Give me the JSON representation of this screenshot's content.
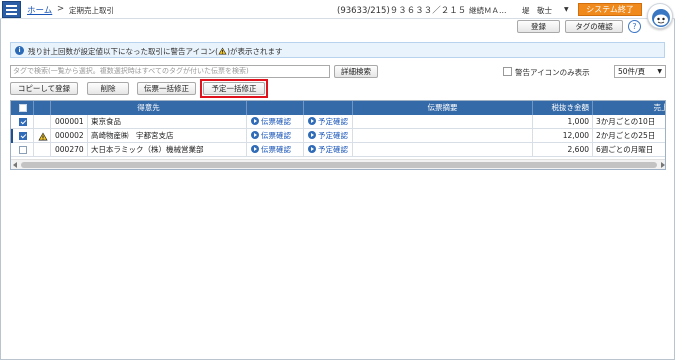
{
  "header": {
    "home_link": "ホーム",
    "breadcrumb_separator": ">",
    "current_page": "定期売上取引",
    "user_info": "(93633/215)９３６３３／２１５",
    "company": "継続ＭＡ…",
    "username": "堤　敬士",
    "user_caret": "▼",
    "system_end_label": "システム終了"
  },
  "toolbar": {
    "register_label": "登録",
    "tag_check_label": "タグの確認",
    "help_label": "?"
  },
  "info_bar": {
    "text_before": "残り計上回数が設定値以下になった取引に警告アイコン(",
    "text_after": ")が表示されます"
  },
  "search": {
    "placeholder": "タグで検索(一覧から選択。複数選択時はすべてのタグが付いた伝票を検索)",
    "detail_search_label": "詳細検索",
    "warn_only_label": "警告アイコンのみ表示",
    "per_page_value": "50件/頁"
  },
  "actions": {
    "copy_register_label": "コピーして登録",
    "delete_label": "削除",
    "voucher_bulk_edit_label": "伝票一括修正",
    "schedule_bulk_edit_label": "予定一括修正"
  },
  "table": {
    "headers": {
      "customer": "得意先",
      "voucher_summary": "伝票摘要",
      "amount_ex_tax": "税抜き金額",
      "sales_schedule": "売上計"
    },
    "rows": [
      {
        "checked": true,
        "warning": false,
        "code": "000001",
        "name": "東京食品",
        "voucher_link": "伝票確認",
        "schedule_link": "予定確認",
        "summary": "",
        "amount": "1,000",
        "schedule": "3か月ごとの10日"
      },
      {
        "checked": true,
        "warning": true,
        "code": "000002",
        "name": "高崎物産㈱　宇都宮支店",
        "voucher_link": "伝票確認",
        "schedule_link": "予定確認",
        "summary": "",
        "amount": "12,000",
        "schedule": "2か月ごとの25日"
      },
      {
        "checked": false,
        "warning": false,
        "code": "000270",
        "name": "大日本ラミック（株）機械営業部",
        "voucher_link": "伝票確認",
        "schedule_link": "予定確認",
        "summary": "",
        "amount": "2,600",
        "schedule": "6週ごとの月曜日"
      }
    ]
  },
  "colors": {
    "header_blue": "#356aa8",
    "accent_orange": "#f08a1c",
    "highlight_red": "#e0121c",
    "link_blue": "#1a55b8"
  }
}
